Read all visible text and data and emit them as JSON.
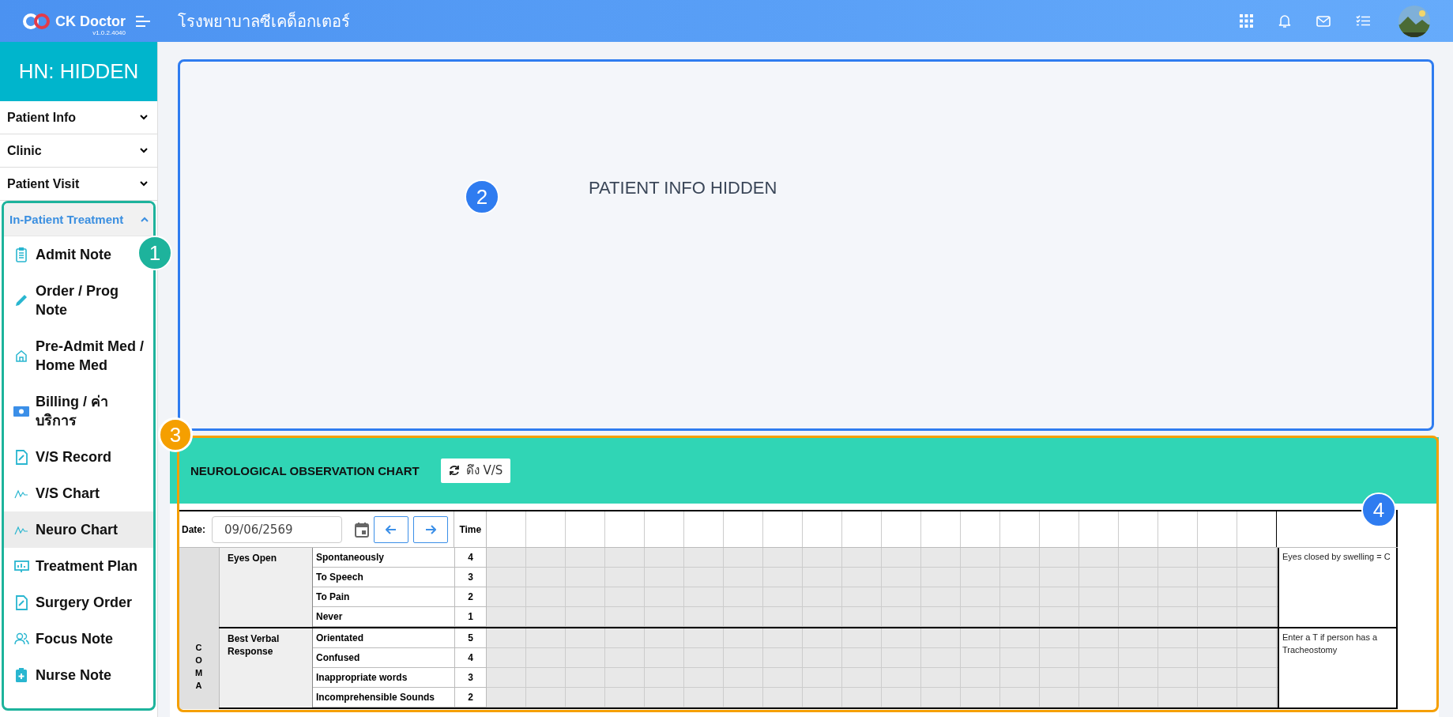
{
  "topbar": {
    "brand": "CK Doctor",
    "version": "v1.0.2.4040",
    "hospital": "โรงพยาบาลซีเคด็อกเตอร์"
  },
  "sidebar": {
    "hn": "HN: HIDDEN",
    "menus": [
      {
        "label": "Patient Info",
        "expanded": false
      },
      {
        "label": "Clinic",
        "expanded": false
      },
      {
        "label": "Patient Visit",
        "expanded": false
      },
      {
        "label": "In-Patient Treatment",
        "expanded": true,
        "children": [
          {
            "label": "Admit Note",
            "selected": false
          },
          {
            "label": "Order / Prog Note",
            "selected": false
          },
          {
            "label": "Pre-Admit Med / Home Med",
            "selected": false
          },
          {
            "label": "Billing / ค่าบริการ",
            "selected": false
          },
          {
            "label": "V/S Record",
            "selected": false
          },
          {
            "label": "V/S Chart",
            "selected": false
          },
          {
            "label": "Neuro Chart",
            "selected": true
          },
          {
            "label": "Treatment Plan",
            "selected": false
          },
          {
            "label": "Surgery Order",
            "selected": false
          },
          {
            "label": "Focus Note",
            "selected": false
          },
          {
            "label": "Nurse Note",
            "selected": false
          }
        ]
      }
    ]
  },
  "patient_info": {
    "text": "PATIENT INFO HIDDEN"
  },
  "neuro_chart": {
    "title": "NEUROLOGICAL OBSERVATION CHART",
    "pull_button": "ดึง V/S",
    "date_label": "Date:",
    "date": "09/06/2569",
    "time_label": "Time",
    "section": "COMA",
    "groups": [
      {
        "name": "Eyes Open",
        "note": "Eyes closed by swelling = C",
        "options": [
          {
            "label": "Spontaneously",
            "score": "4"
          },
          {
            "label": "To Speech",
            "score": "3"
          },
          {
            "label": "To Pain",
            "score": "2"
          },
          {
            "label": "Never",
            "score": "1"
          }
        ]
      },
      {
        "name": "Best Verbal Response",
        "note": "Enter a T if person has a Tracheostomy",
        "options": [
          {
            "label": "Orientated",
            "score": "5"
          },
          {
            "label": "Confused",
            "score": "4"
          },
          {
            "label": "Inappropriate words",
            "score": "3"
          },
          {
            "label": "Incomprehensible Sounds",
            "score": "2"
          }
        ]
      }
    ]
  },
  "annotations": [
    {
      "label": "1",
      "color": "#1db39c"
    },
    {
      "label": "2",
      "color": "#2f7cf0"
    },
    {
      "label": "3",
      "color": "#f59f00"
    },
    {
      "label": "4",
      "color": "#2f7cf0"
    }
  ]
}
